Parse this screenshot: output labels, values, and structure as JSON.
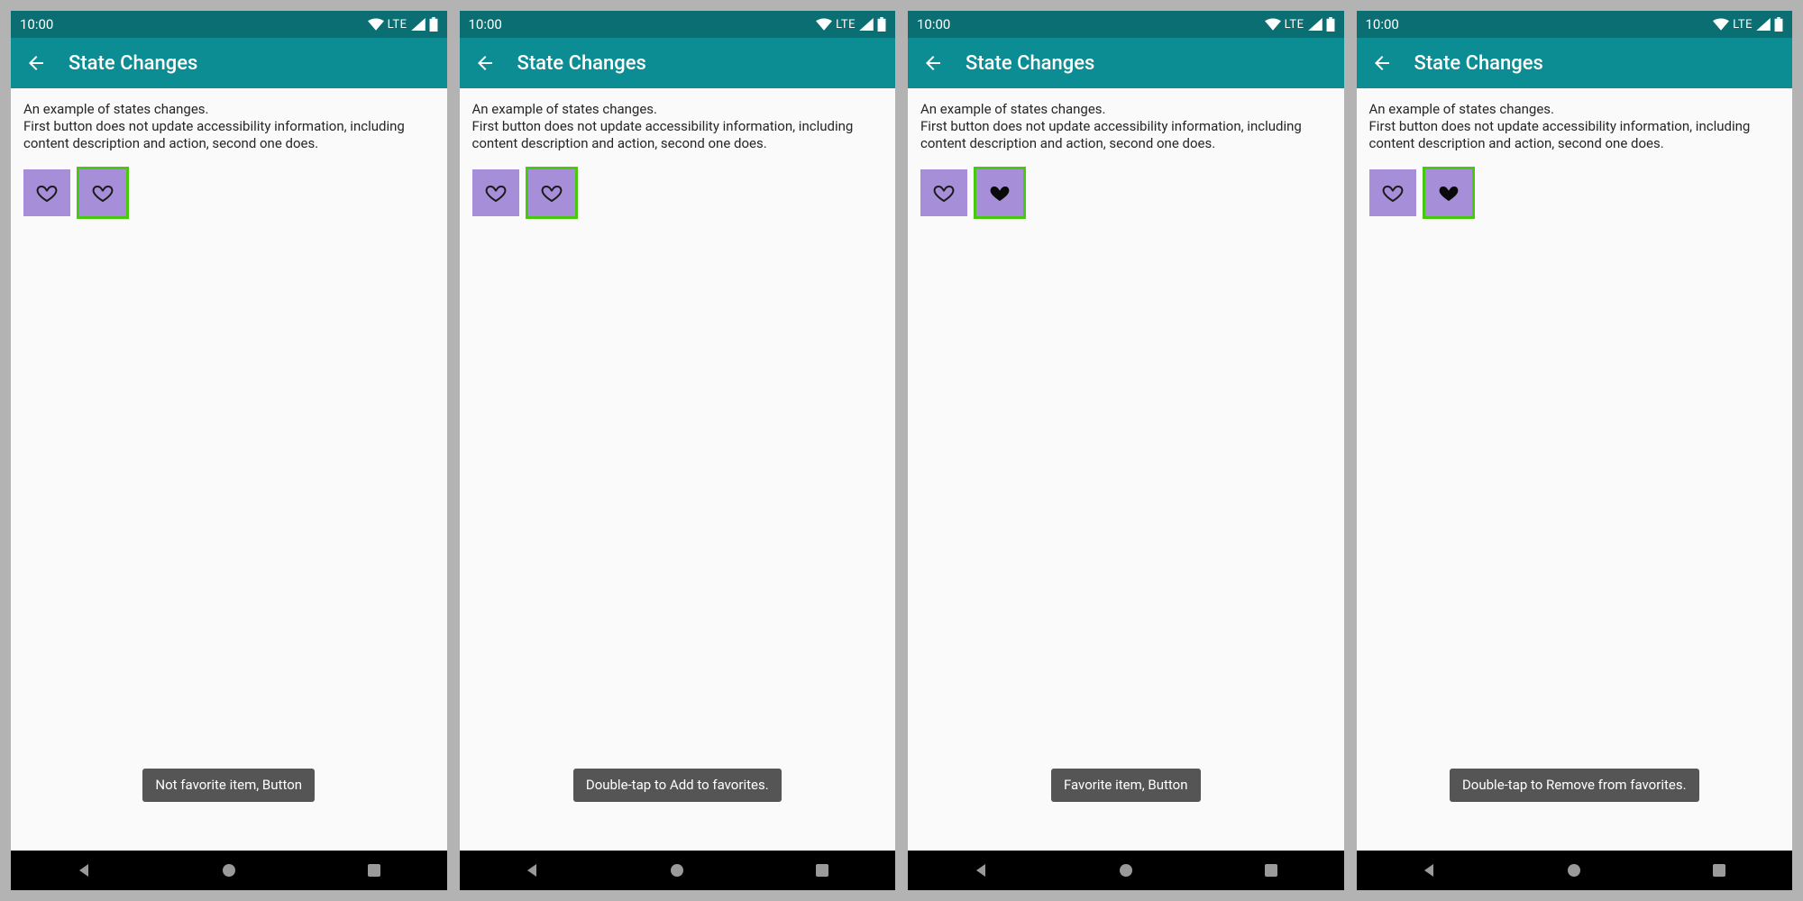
{
  "status": {
    "time": "10:00",
    "network_label": "LTE"
  },
  "appbar": {
    "title": "State Changes"
  },
  "description": "An example of states changes.\nFirst button does not update accessibility information, including content description and action, second one does.",
  "screens": [
    {
      "button2_filled": false,
      "button2_focused": true,
      "toast": "Not favorite item, Button"
    },
    {
      "button2_filled": false,
      "button2_focused": true,
      "toast": "Double-tap to Add to favorites."
    },
    {
      "button2_filled": true,
      "button2_focused": true,
      "toast": "Favorite item, Button"
    },
    {
      "button2_filled": true,
      "button2_focused": true,
      "toast": "Double-tap to Remove from favorites."
    }
  ],
  "colors": {
    "statusbar": "#0a6e72",
    "appbar": "#0c8c93",
    "button": "#a68ed8",
    "focus": "#47c90e",
    "toast": "#555555"
  }
}
